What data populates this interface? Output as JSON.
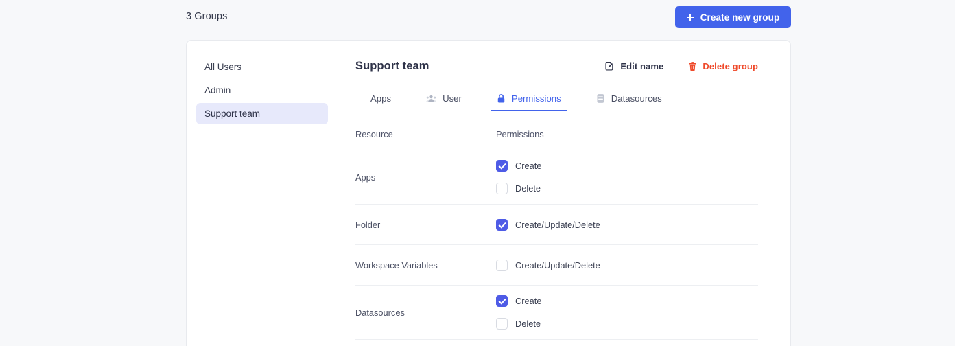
{
  "topbar": {
    "groups_count_label": "3 Groups",
    "create_button_label": "Create new group"
  },
  "sidebar": {
    "items": [
      {
        "label": "All Users",
        "active": false
      },
      {
        "label": "Admin",
        "active": false
      },
      {
        "label": "Support team",
        "active": true
      }
    ]
  },
  "content": {
    "group_title": "Support team",
    "actions": {
      "edit_name_label": "Edit name",
      "delete_group_label": "Delete group"
    },
    "tabs": [
      {
        "label": "Apps",
        "icon": "grid-icon",
        "active": false
      },
      {
        "label": "User",
        "icon": "users-icon",
        "active": false
      },
      {
        "label": "Permissions",
        "icon": "lock-icon",
        "active": true
      },
      {
        "label": "Datasources",
        "icon": "database-icon",
        "active": false
      }
    ],
    "table": {
      "columns": [
        "Resource",
        "Permissions"
      ],
      "rows": [
        {
          "resource": "Apps",
          "permissions": [
            {
              "label": "Create",
              "checked": true
            },
            {
              "label": "Delete",
              "checked": false
            }
          ]
        },
        {
          "resource": "Folder",
          "permissions": [
            {
              "label": "Create/Update/Delete",
              "checked": true
            }
          ]
        },
        {
          "resource": "Workspace Variables",
          "permissions": [
            {
              "label": "Create/Update/Delete",
              "checked": false
            }
          ]
        },
        {
          "resource": "Datasources",
          "permissions": [
            {
              "label": "Create",
              "checked": true
            },
            {
              "label": "Delete",
              "checked": false
            }
          ]
        }
      ]
    }
  },
  "colors": {
    "accent_blue": "#4263eb",
    "checkbox_blue": "#4e5be6",
    "danger_red": "#ef4a2b",
    "active_nav_bg": "#e7e9fb",
    "page_bg": "#f7f8fa"
  }
}
